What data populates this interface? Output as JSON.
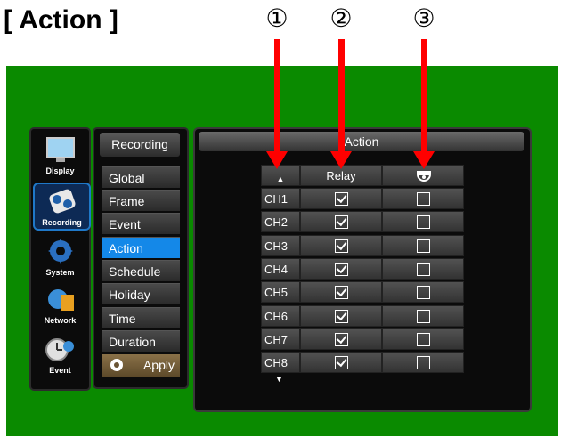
{
  "heading": "[ Action ]",
  "callouts": [
    "①",
    "②",
    "③"
  ],
  "side_menu": [
    {
      "label": "Display",
      "icon": "monitor-icon",
      "selected": false
    },
    {
      "label": "Recording",
      "icon": "recording-icon",
      "selected": true
    },
    {
      "label": "System",
      "icon": "system-gear-icon",
      "selected": false
    },
    {
      "label": "Network",
      "icon": "network-icon",
      "selected": false
    },
    {
      "label": "Event",
      "icon": "event-clock-icon",
      "selected": false
    }
  ],
  "submenu": {
    "title": "Recording",
    "items": [
      "Global",
      "Frame",
      "Event",
      "Action",
      "Schedule",
      "Holiday",
      "Time",
      "Duration"
    ],
    "active": "Action",
    "apply_label": "Apply"
  },
  "panel": {
    "title": "Action",
    "columns": {
      "up_arrow": "▲",
      "relay": "Relay",
      "buzzer_icon": "alarm-buzzer-icon"
    },
    "down_arrow": "▼",
    "rows": [
      {
        "ch": "CH1",
        "relay": true,
        "buzzer": false
      },
      {
        "ch": "CH2",
        "relay": true,
        "buzzer": false
      },
      {
        "ch": "CH3",
        "relay": true,
        "buzzer": false
      },
      {
        "ch": "CH4",
        "relay": true,
        "buzzer": false
      },
      {
        "ch": "CH5",
        "relay": true,
        "buzzer": false
      },
      {
        "ch": "CH6",
        "relay": true,
        "buzzer": false
      },
      {
        "ch": "CH7",
        "relay": true,
        "buzzer": false
      },
      {
        "ch": "CH8",
        "relay": true,
        "buzzer": false
      }
    ]
  },
  "colors": {
    "background": "#0a8a00",
    "active_item": "#1488e8",
    "callout_arrow": "#ff0000"
  }
}
